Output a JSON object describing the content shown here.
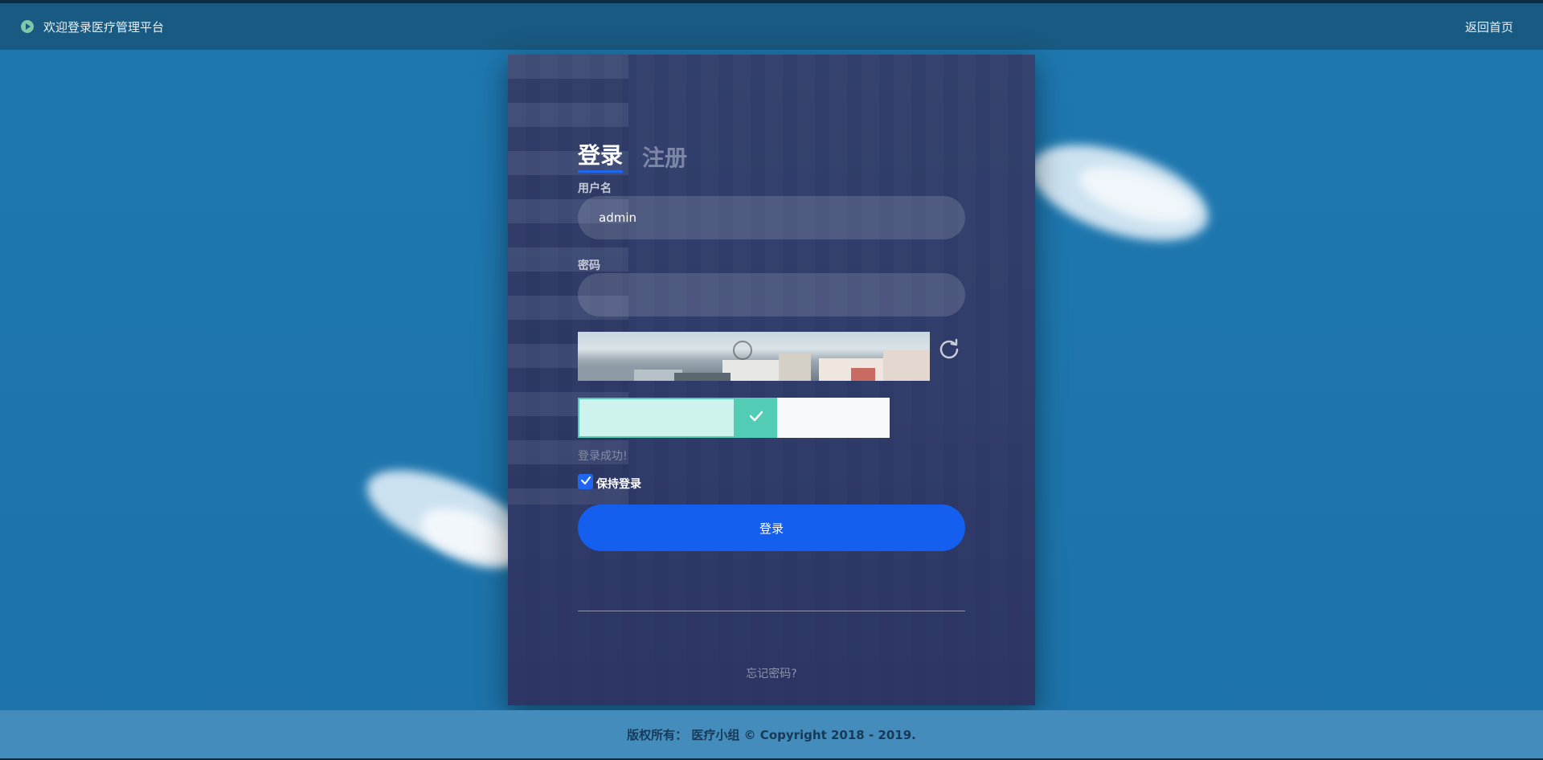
{
  "header": {
    "welcome": "欢迎登录医疗管理平台",
    "back_home": "返回首页"
  },
  "tabs": [
    {
      "label": "登录",
      "active": true
    },
    {
      "label": "注册",
      "active": false
    }
  ],
  "form": {
    "username_label": "用户名",
    "username_value": "admin",
    "password_label": "密码",
    "password_value": "",
    "slider_status": "登录成功!",
    "slider_progress": 0.62,
    "remember_label": "保持登录",
    "remember_checked": true,
    "submit_label": "登录",
    "forgot_label": "忘记密码?"
  },
  "icons": {
    "brand": "play-circle-icon",
    "refresh": "refresh-icon",
    "slider_handle": "check-icon",
    "checkbox": "checkmark-icon"
  },
  "colors": {
    "primary": "#155fee",
    "success": "#52ccb5",
    "background": "#1e78b0",
    "header": "#195a82"
  },
  "footer": {
    "copyright": "版权所有： 医疗小组 © Copyright 2018 - 2019."
  }
}
